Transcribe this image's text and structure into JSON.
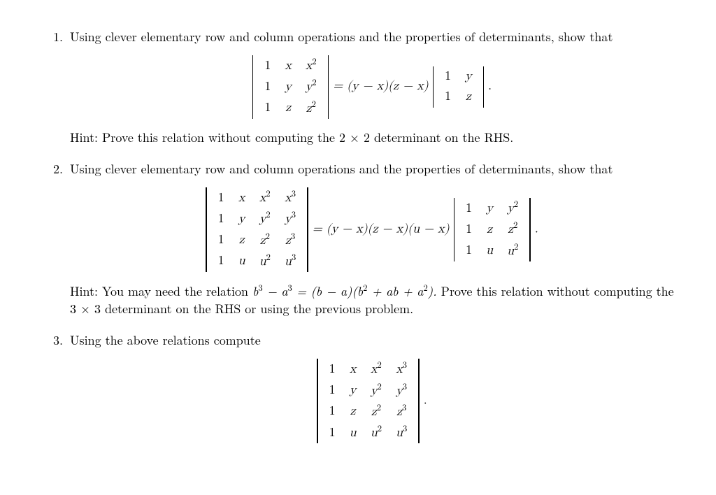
{
  "problems": [
    {
      "num": "1.",
      "intro": "Using clever elementary row and column operations and the properties of determinants, show that",
      "hint_label": "Hint:",
      "hint": "Prove this relation without computing the 2 × 2 determinant on the RHS."
    },
    {
      "num": "2.",
      "intro": "Using clever elementary row and column operations and the properties of determinants, show that",
      "hint_label": "Hint:",
      "hint_a": "You may need the relation ",
      "hint_math": "b³ − a³ = (b − a)(b² + ab + a²).",
      "hint_b": " Prove this relation without computing the 3 × 3 determinant on the RHS or using the previous problem."
    },
    {
      "num": "3.",
      "intro": "Using the above relations compute"
    }
  ],
  "eq1_mid": " = (y − x)(z − x) ",
  "eq2_mid": " = (y − x)(z − x)(u − x) ",
  "period": ".",
  "det3x3": [
    [
      "1",
      "x",
      "x²"
    ],
    [
      "1",
      "y",
      "y²"
    ],
    [
      "1",
      "z",
      "z²"
    ]
  ],
  "det2x2": [
    [
      "1",
      "y"
    ],
    [
      "1",
      "z"
    ]
  ],
  "det4x4": [
    [
      "1",
      "x",
      "x²",
      "x³"
    ],
    [
      "1",
      "y",
      "y²",
      "y³"
    ],
    [
      "1",
      "z",
      "z²",
      "z³"
    ],
    [
      "1",
      "u",
      "u²",
      "u³"
    ]
  ],
  "det3x3b": [
    [
      "1",
      "y",
      "y²"
    ],
    [
      "1",
      "z",
      "z²"
    ],
    [
      "1",
      "u",
      "u²"
    ]
  ],
  "chart_data": null
}
